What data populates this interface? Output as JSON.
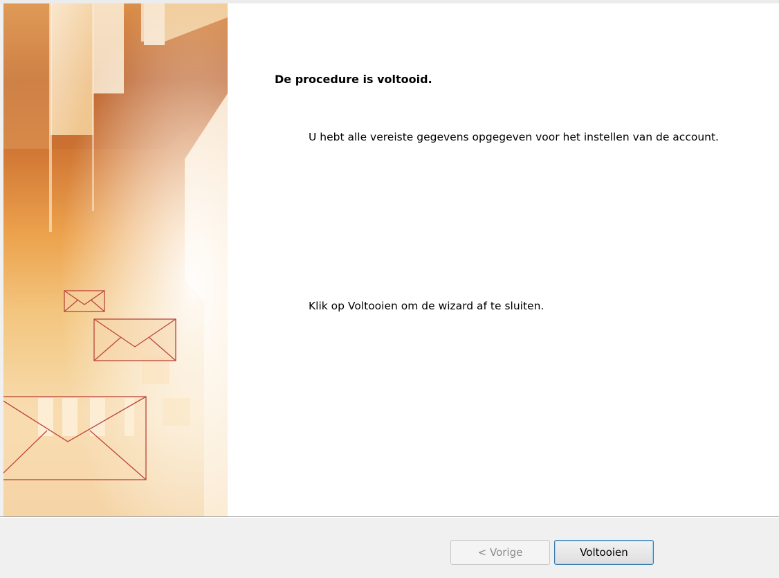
{
  "wizard": {
    "heading": "De procedure is voltooid.",
    "body": "U hebt alle vereiste gegevens opgegeven voor het instellen van de account.",
    "hint": "Klik op Voltooien om de wizard af te sluiten."
  },
  "buttons": {
    "back_label": "< Vorige",
    "finish_label": "Voltooien"
  },
  "colors": {
    "banner_orange": "#c8602a",
    "banner_light": "#fbe9c8",
    "envelope_stroke": "#b8453a",
    "accent_border": "#3c7fb1"
  }
}
